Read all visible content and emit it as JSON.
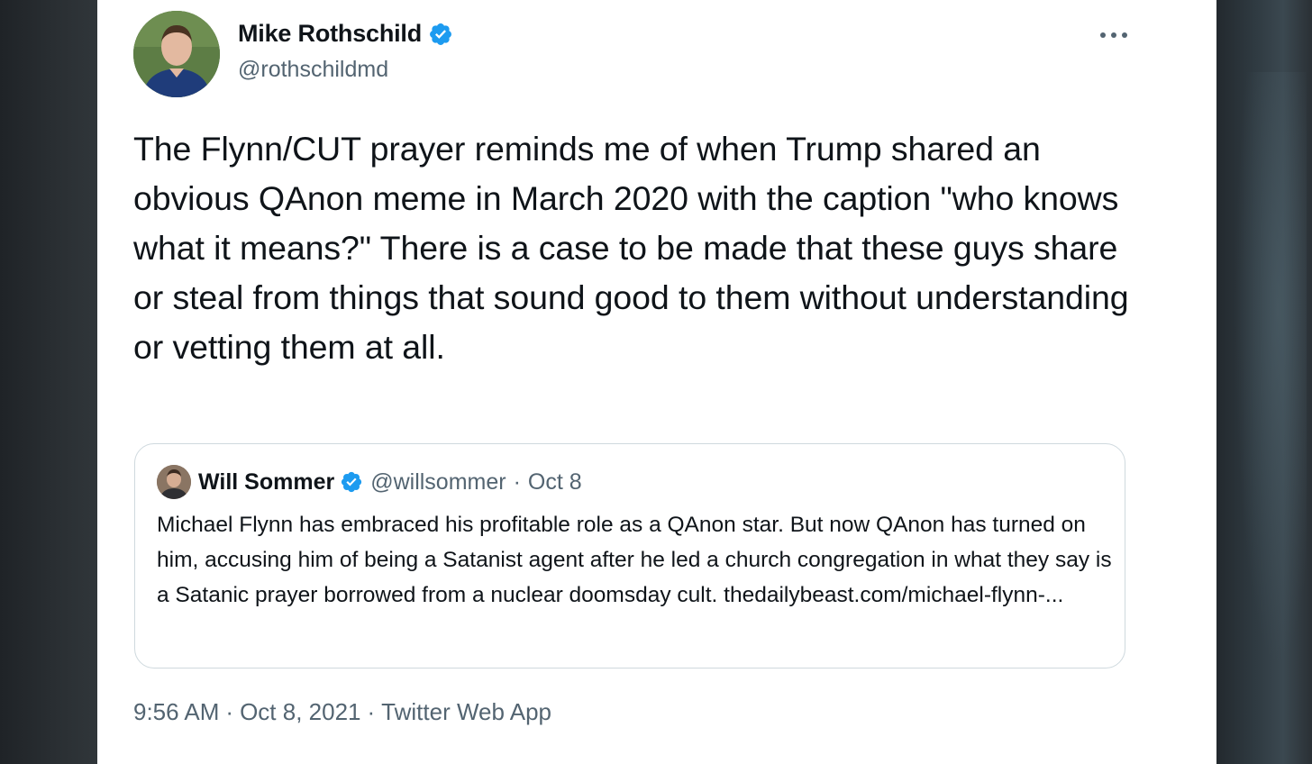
{
  "tweet": {
    "author_name": "Mike Rothschild",
    "author_handle": "@rothschildmd",
    "more_icon": "more-horizontal-icon",
    "text": "The Flynn/CUT prayer reminds me of when Trump shared an obvious QAnon meme in March 2020 with the caption \"who knows what it means?\" There is a case to be made that these guys share or steal from things that sound good to them without understanding or vetting them at all.",
    "time": "9:56 AM",
    "date": "Oct 8, 2021",
    "source": "Twitter Web App"
  },
  "quote": {
    "author_name": "Will Sommer",
    "author_handle": "@willsommer",
    "separator": "·",
    "date": "Oct 8",
    "text": "Michael Flynn has embraced his profitable role as a QAnon star. But now QAnon has turned on him, accusing him of being a Satanist agent after he led a church congregation in what they say is a Satanic prayer borrowed from a nuclear doomsday cult. thedailybeast.com/michael-flynn-..."
  },
  "meta_separator": "·",
  "colors": {
    "verified_blue": "#1d9bf0",
    "text_primary": "#0f1419",
    "text_secondary": "#536471",
    "border": "#cfd9de"
  }
}
